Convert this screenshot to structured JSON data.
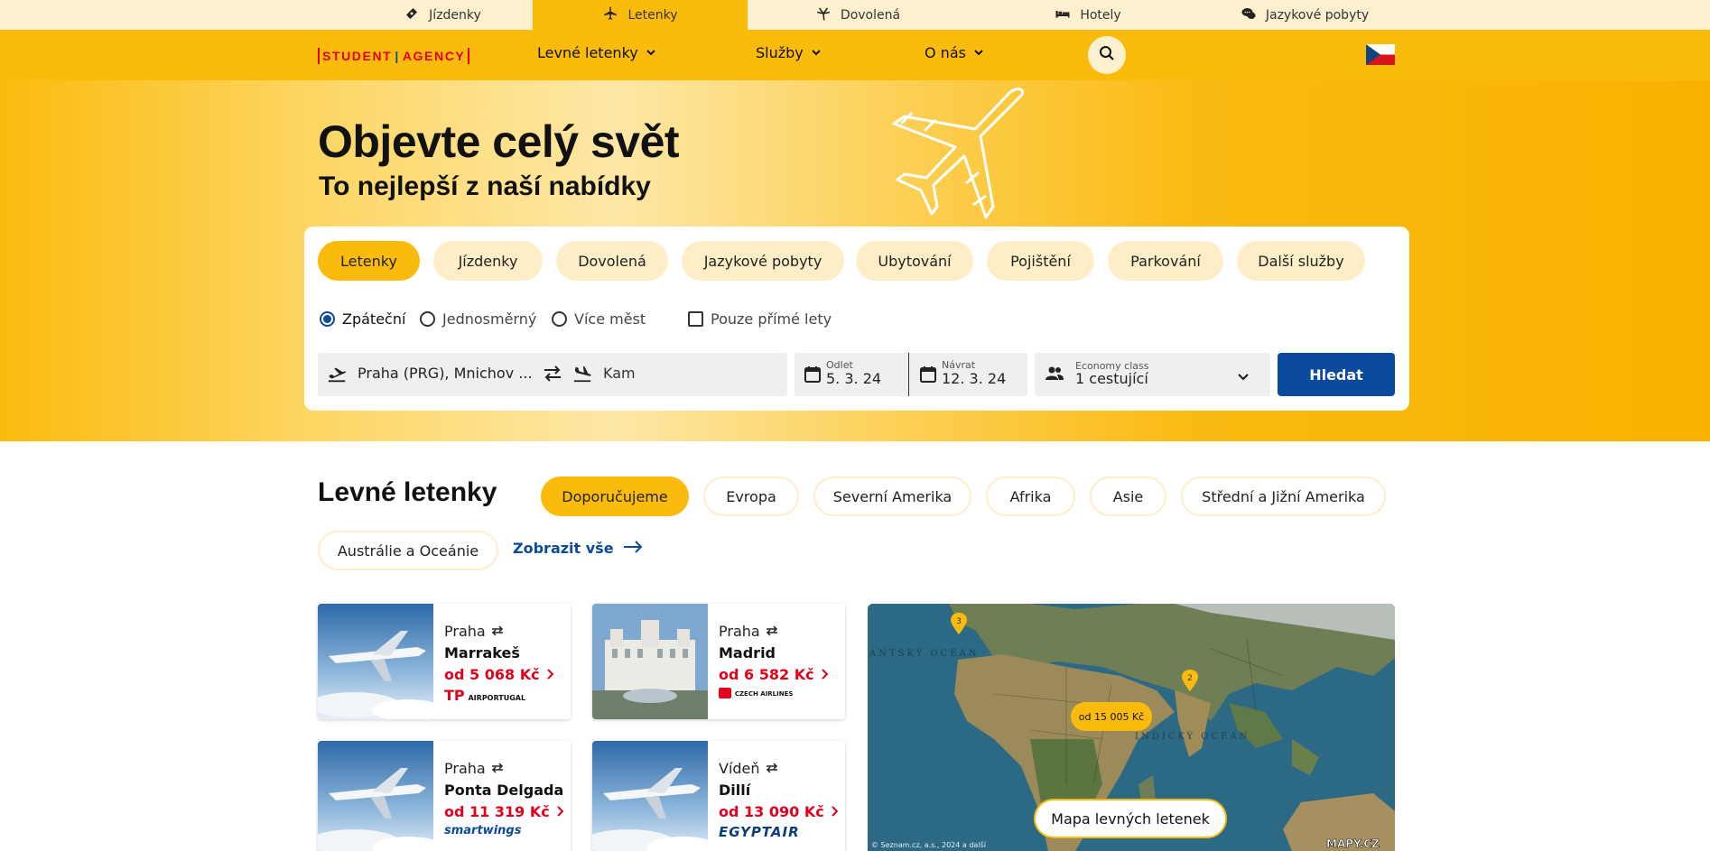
{
  "topnav": {
    "items": [
      {
        "label": "Jízdenky",
        "icon": "ticket-icon"
      },
      {
        "label": "Letenky",
        "icon": "airplane-icon",
        "active": true
      },
      {
        "label": "Dovolená",
        "icon": "palm-tree-icon"
      },
      {
        "label": "Hotely",
        "icon": "bed-icon"
      },
      {
        "label": "Jazykové pobyty",
        "icon": "chat-bubbles-icon"
      }
    ]
  },
  "header": {
    "logo_left": "STUDENT",
    "logo_right": "AGENCY",
    "menu": [
      {
        "label": "Levné letenky"
      },
      {
        "label": "Služby"
      },
      {
        "label": "O nás"
      }
    ],
    "language": "CZ"
  },
  "hero": {
    "title": "Objevte celý svět",
    "subtitle": "To nejlepší z naší nabídky"
  },
  "search": {
    "tabs": [
      "Letenky",
      "Jízdenky",
      "Dovolená",
      "Jazykové pobyty",
      "Ubytování",
      "Pojištění",
      "Parkování",
      "Další služby"
    ],
    "active_tab": "Letenky",
    "trip_types": [
      "Zpáteční",
      "Jednosměrný",
      "Více měst"
    ],
    "selected_trip_type": "Zpáteční",
    "direct_only_label": "Pouze přímé lety",
    "direct_only_checked": false,
    "from_value": "Praha (PRG), Mnichov ...",
    "to_placeholder": "Kam",
    "departure_label": "Odlet",
    "departure_value": "5. 3. 24",
    "return_label": "Návrat",
    "return_value": "12. 3. 24",
    "class_label": "Economy class",
    "passengers_value": "1 cestující",
    "submit_label": "Hledat"
  },
  "deals": {
    "title": "Levné letenky",
    "filters": [
      "Doporučujeme",
      "Evropa",
      "Severní Amerika",
      "Afrika",
      "Asie",
      "Střední a Jižní Amerika",
      "Austrálie a Oceánie"
    ],
    "active_filter": "Doporučujeme",
    "show_all_label": "Zobrazit vše",
    "offers": [
      {
        "from": "Praha",
        "to": "Marrakeš",
        "price": "od 5 068 Kč",
        "airline": "AIRPORTUGAL"
      },
      {
        "from": "Praha",
        "to": "Madrid",
        "price": "od 6 582 Kč",
        "airline": "CZECH AIRLINES"
      },
      {
        "from": "Praha",
        "to": "Ponta Delgada",
        "price": "od 11 319 Kč",
        "airline": "smartwings"
      },
      {
        "from": "Vídeň",
        "to": "Dillí",
        "price": "od 13 090 Kč",
        "airline": "EGYPTAIR"
      }
    ]
  },
  "map": {
    "button_label": "Mapa levných letenek",
    "price_bubble": "od 15 005 Kč",
    "marker_1": "3",
    "marker_2": "2",
    "label_atlantic": "ANTSKÝ OCEÁN",
    "label_indian": "INDICKÝ OCEÁN",
    "copyright": "© Seznam.cz, a.s., 2024 a další",
    "brand": "MAPY.CZ"
  },
  "colors": {
    "brand_yellow": "#fbbb0d",
    "brand_blue": "#0b4a9c",
    "price_red": "#e3001b",
    "pill_bg": "#fdeec7"
  }
}
